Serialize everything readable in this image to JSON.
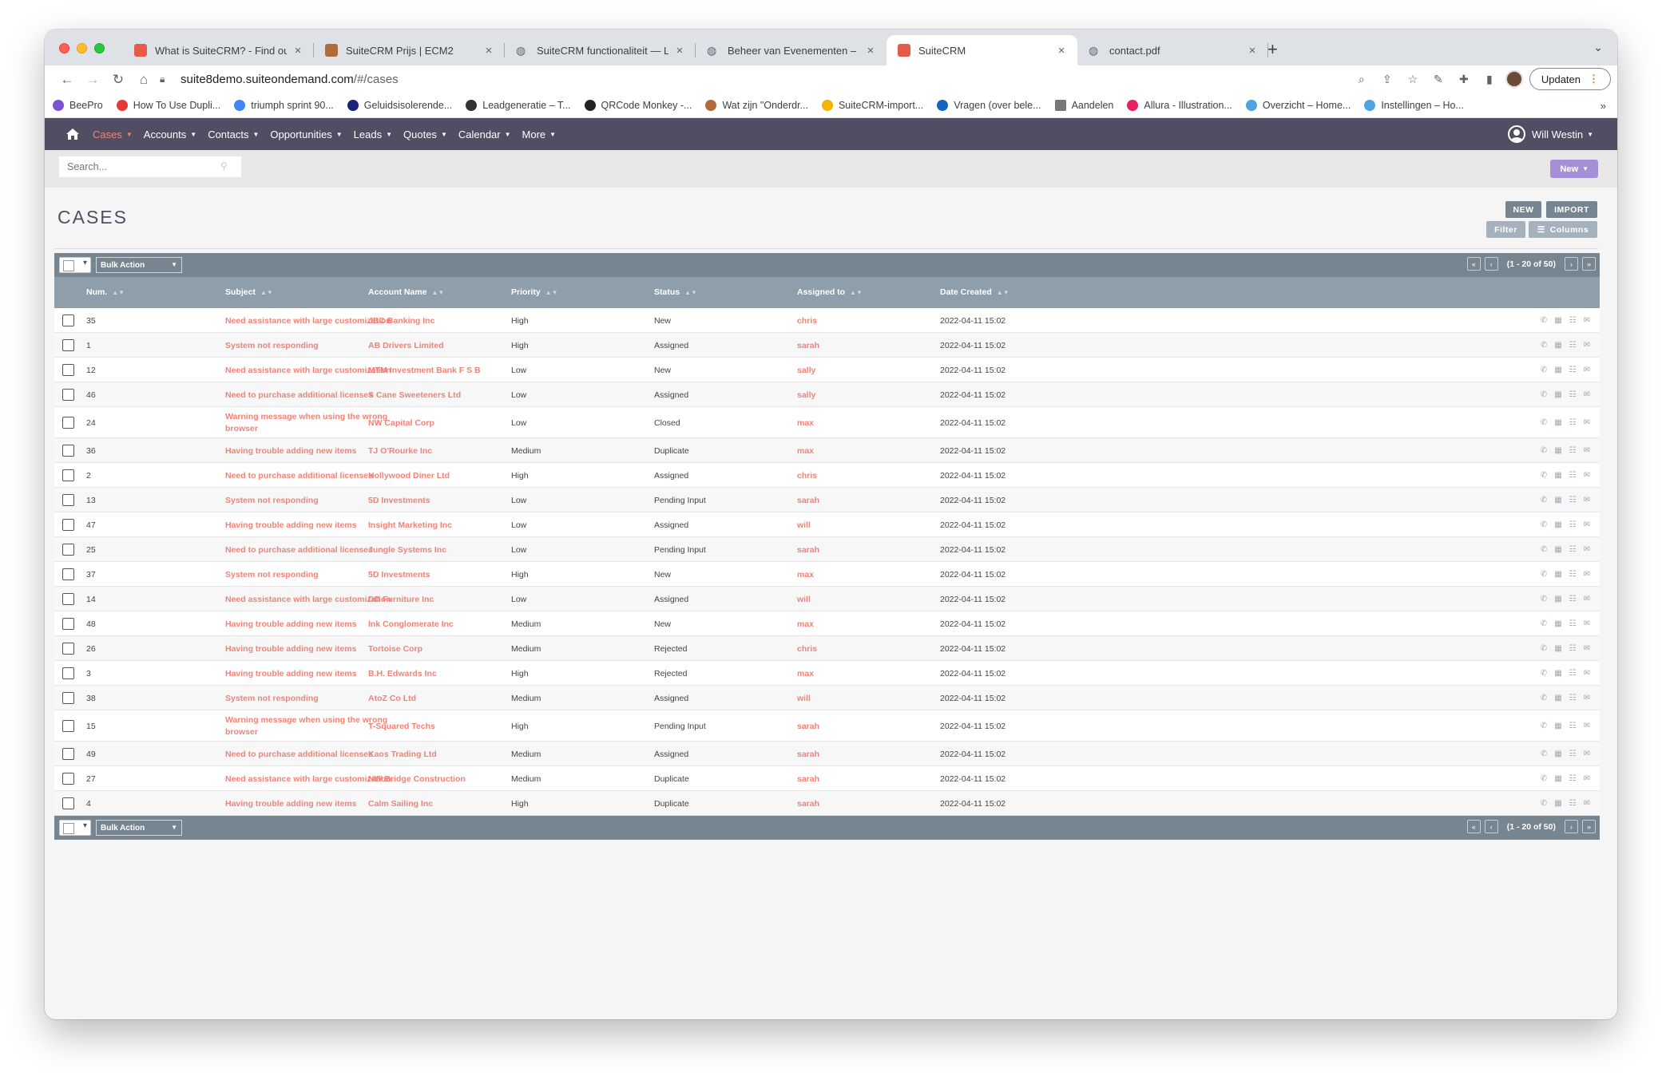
{
  "browser": {
    "tabs": [
      {
        "title": "What is SuiteCRM? - Find out f",
        "icon": "suitecrm-favicon",
        "color": "#e45b4c"
      },
      {
        "title": "SuiteCRM Prijs | ECM2",
        "icon": "ecm2-favicon",
        "color": "#b06a3c"
      },
      {
        "title": "SuiteCRM functionaliteit — Lap",
        "icon": "globe-icon",
        "color": "#5f6368"
      },
      {
        "title": "Beheer van Evenementen – Sw",
        "icon": "globe-icon",
        "color": "#5f6368"
      },
      {
        "title": "SuiteCRM",
        "icon": "suitecrm-favicon",
        "color": "#e45b4c",
        "active": true
      },
      {
        "title": "contact.pdf",
        "icon": "globe-icon",
        "color": "#5f6368"
      }
    ],
    "url_host": "suite8demo.suiteondemand.com",
    "url_path": "/#/cases",
    "update_label": "Updaten",
    "bookmarks": [
      {
        "label": "BeePro",
        "color": "#7b52d4"
      },
      {
        "label": "How To Use Dupli...",
        "color": "#e53935"
      },
      {
        "label": "triumph sprint 90...",
        "color": "#4285f4"
      },
      {
        "label": "Geluidsisolerende...",
        "color": "#1a237e"
      },
      {
        "label": "Leadgeneratie – T...",
        "color": "#333333"
      },
      {
        "label": "QRCode Monkey -...",
        "color": "#222222"
      },
      {
        "label": "Wat zijn \"Onderdr...",
        "color": "#b06a3c"
      },
      {
        "label": "SuiteCRM-import...",
        "color": "#f4b400"
      },
      {
        "label": "Vragen (over bele...",
        "color": "#1565c0"
      },
      {
        "label": "Aandelen",
        "color": "#777777"
      },
      {
        "label": "Allura - Illustration...",
        "color": "#e91e63"
      },
      {
        "label": "Overzicht – Home...",
        "color": "#4fa3e0"
      },
      {
        "label": "Instellingen – Ho...",
        "color": "#4fa3e0"
      }
    ]
  },
  "crm": {
    "nav": [
      {
        "label": "Cases",
        "active": true
      },
      {
        "label": "Accounts"
      },
      {
        "label": "Contacts"
      },
      {
        "label": "Opportunities"
      },
      {
        "label": "Leads"
      },
      {
        "label": "Quotes"
      },
      {
        "label": "Calendar"
      },
      {
        "label": "More"
      }
    ],
    "user_name": "Will Westin",
    "search_placeholder": "Search...",
    "new_label": "New",
    "page_title": "CASES",
    "btn_new": "NEW",
    "btn_import": "IMPORT",
    "btn_filter": "Filter",
    "btn_columns": "Columns",
    "bulk_action": "Bulk Action",
    "pagination": "(1 - 20 of 50)",
    "columns": [
      "Num.",
      "Subject",
      "Account Name",
      "Priority",
      "Status",
      "Assigned to",
      "Date Created"
    ],
    "colors": {
      "nav_bg": "#534d64",
      "accent": "#f08377",
      "table_bar": "#778591",
      "header": "#8f9eab"
    },
    "rows": [
      {
        "num": "35",
        "subject": "Need assistance with large customization",
        "account": "JBC Banking Inc",
        "priority": "High",
        "status": "New",
        "assigned": "chris",
        "date": "2022-04-11 15:02"
      },
      {
        "num": "1",
        "subject": "System not responding",
        "account": "AB Drivers Limited",
        "priority": "High",
        "status": "Assigned",
        "assigned": "sarah",
        "date": "2022-04-11 15:02"
      },
      {
        "num": "12",
        "subject": "Need assistance with large customization",
        "account": "MTM Investment Bank F S B",
        "priority": "Low",
        "status": "New",
        "assigned": "sally",
        "date": "2022-04-11 15:02"
      },
      {
        "num": "46",
        "subject": "Need to purchase additional licenses",
        "account": "S Cane Sweeteners Ltd",
        "priority": "Low",
        "status": "Assigned",
        "assigned": "sally",
        "date": "2022-04-11 15:02"
      },
      {
        "num": "24",
        "subject": "Warning message when using the wrong",
        "subject2": "browser",
        "account": "NW Capital Corp",
        "priority": "Low",
        "status": "Closed",
        "assigned": "max",
        "date": "2022-04-11 15:02"
      },
      {
        "num": "36",
        "subject": "Having trouble adding new items",
        "account": "TJ O'Rourke Inc",
        "priority": "Medium",
        "status": "Duplicate",
        "assigned": "max",
        "date": "2022-04-11 15:02"
      },
      {
        "num": "2",
        "subject": "Need to purchase additional licenses",
        "account": "Hollywood Diner Ltd",
        "priority": "High",
        "status": "Assigned",
        "assigned": "chris",
        "date": "2022-04-11 15:02"
      },
      {
        "num": "13",
        "subject": "System not responding",
        "account": "5D Investments",
        "priority": "Low",
        "status": "Pending Input",
        "assigned": "sarah",
        "date": "2022-04-11 15:02"
      },
      {
        "num": "47",
        "subject": "Having trouble adding new items",
        "account": "Insight Marketing Inc",
        "priority": "Low",
        "status": "Assigned",
        "assigned": "will",
        "date": "2022-04-11 15:02"
      },
      {
        "num": "25",
        "subject": "Need to purchase additional licenses",
        "account": "Jungle Systems Inc",
        "priority": "Low",
        "status": "Pending Input",
        "assigned": "sarah",
        "date": "2022-04-11 15:02"
      },
      {
        "num": "37",
        "subject": "System not responding",
        "account": "5D Investments",
        "priority": "High",
        "status": "New",
        "assigned": "max",
        "date": "2022-04-11 15:02"
      },
      {
        "num": "14",
        "subject": "Need assistance with large customization",
        "account": "DD Furniture Inc",
        "priority": "Low",
        "status": "Assigned",
        "assigned": "will",
        "date": "2022-04-11 15:02"
      },
      {
        "num": "48",
        "subject": "Having trouble adding new items",
        "account": "Ink Conglomerate Inc",
        "priority": "Medium",
        "status": "New",
        "assigned": "max",
        "date": "2022-04-11 15:02"
      },
      {
        "num": "26",
        "subject": "Having trouble adding new items",
        "account": "Tortoise Corp",
        "priority": "Medium",
        "status": "Rejected",
        "assigned": "chris",
        "date": "2022-04-11 15:02"
      },
      {
        "num": "3",
        "subject": "Having trouble adding new items",
        "account": "B.H. Edwards Inc",
        "priority": "High",
        "status": "Rejected",
        "assigned": "max",
        "date": "2022-04-11 15:02"
      },
      {
        "num": "38",
        "subject": "System not responding",
        "account": "AtoZ Co Ltd",
        "priority": "Medium",
        "status": "Assigned",
        "assigned": "will",
        "date": "2022-04-11 15:02"
      },
      {
        "num": "15",
        "subject": "Warning message when using the wrong",
        "subject2": "browser",
        "account": "T-Squared Techs",
        "priority": "High",
        "status": "Pending Input",
        "assigned": "sarah",
        "date": "2022-04-11 15:02"
      },
      {
        "num": "49",
        "subject": "Need to purchase additional licenses",
        "account": "Kaos Trading Ltd",
        "priority": "Medium",
        "status": "Assigned",
        "assigned": "sarah",
        "date": "2022-04-11 15:02"
      },
      {
        "num": "27",
        "subject": "Need assistance with large customization",
        "account": "NW Bridge Construction",
        "priority": "Medium",
        "status": "Duplicate",
        "assigned": "sarah",
        "date": "2022-04-11 15:02"
      },
      {
        "num": "4",
        "subject": "Having trouble adding new items",
        "account": "Calm Sailing Inc",
        "priority": "High",
        "status": "Duplicate",
        "assigned": "sarah",
        "date": "2022-04-11 15:02"
      }
    ]
  }
}
